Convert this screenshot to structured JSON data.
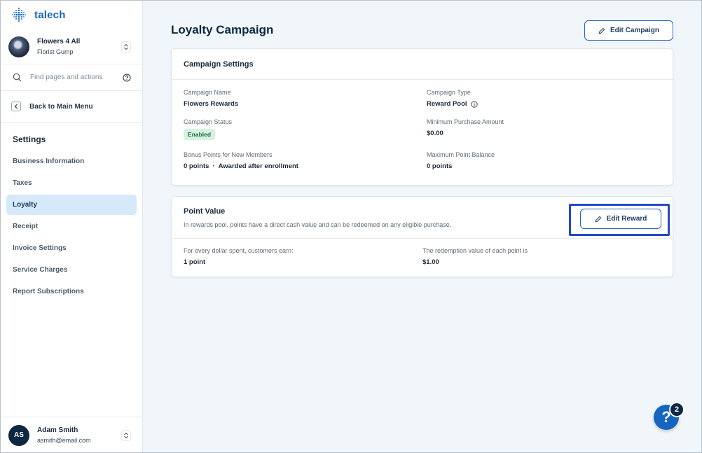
{
  "brand": {
    "name": "talech",
    "accent": "#1565c0"
  },
  "account": {
    "name": "Flowers 4 All",
    "subtitle": "Florist Gump"
  },
  "search": {
    "placeholder": "Find pages and actions"
  },
  "back": {
    "label": "Back to Main Menu"
  },
  "sidebar": {
    "section_title": "Settings",
    "items": [
      {
        "label": "Business Information",
        "active": false
      },
      {
        "label": "Taxes",
        "active": false
      },
      {
        "label": "Loyalty",
        "active": true
      },
      {
        "label": "Receipt",
        "active": false
      },
      {
        "label": "Invoice Settings",
        "active": false
      },
      {
        "label": "Service Charges",
        "active": false
      },
      {
        "label": "Report Subscriptions",
        "active": false
      }
    ]
  },
  "user": {
    "initials": "AS",
    "name": "Adam Smith",
    "email": "asmith@email.com"
  },
  "page": {
    "title": "Loyalty Campaign",
    "edit_campaign_label": "Edit Campaign"
  },
  "campaign_settings": {
    "title": "Campaign Settings",
    "campaign_name_label": "Campaign Name",
    "campaign_name": "Flowers Rewards",
    "campaign_type_label": "Campaign Type",
    "campaign_type": "Reward Pool",
    "campaign_status_label": "Campaign Status",
    "campaign_status": "Enabled",
    "min_purchase_label": "Minimum Purchase Amount",
    "min_purchase": "$0.00",
    "bonus_points_label": "Bonus Points for New Members",
    "bonus_points": "0 points",
    "bonus_points_note": "Awarded after enrollment",
    "max_balance_label": "Maximum Point Balance",
    "max_balance": "0 points"
  },
  "point_value": {
    "title": "Point Value",
    "description": "In rewards pool, points have a direct cash value and can be redeemed on any eligible purchase.",
    "edit_reward_label": "Edit Reward",
    "earn_label": "For every dollar spent, customers earn:",
    "earn_value": "1 point",
    "redemption_label": "The redemption value of each point is",
    "redemption_value": "$1.00"
  },
  "help": {
    "glyph": "?",
    "count": "2"
  }
}
